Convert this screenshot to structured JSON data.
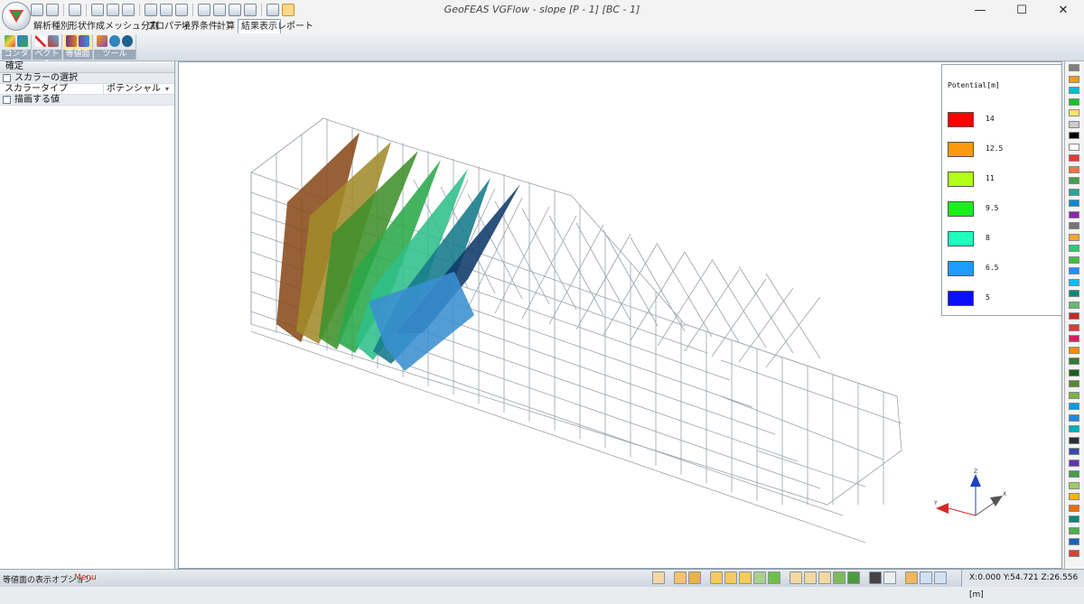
{
  "window": {
    "title": "GeoFEAS VGFlow - slope [P - 1] [BC - 1]",
    "controls": {
      "minimize": "—",
      "maximize": "☐",
      "close": "✕"
    }
  },
  "tabs": [
    "解析種別",
    "形状作成",
    "メッシュ分割",
    "プロパティ",
    "境界条件",
    "計算",
    "結果表示",
    "レポート"
  ],
  "active_tab": "結果表示",
  "ribbon": {
    "groups": [
      "コンタ図",
      "ベクトル",
      "等値面",
      "ツール"
    ],
    "selected_group": "等値面"
  },
  "left_panel": {
    "header": "確定",
    "section_scalar": "スカラーの選択",
    "scalar_type_label": "スカラータイプ",
    "scalar_type_value": "ポテンシャル",
    "section_values": "描画する値"
  },
  "legend": {
    "title": "Potential[m]",
    "items": [
      {
        "value": "14",
        "color": "#ff0000"
      },
      {
        "value": "12.5",
        "color": "#ff9a10"
      },
      {
        "value": "11",
        "color": "#b2ff18"
      },
      {
        "value": "9.5",
        "color": "#1af01a"
      },
      {
        "value": "8",
        "color": "#1fffbe"
      },
      {
        "value": "6.5",
        "color": "#1f9cff"
      },
      {
        "value": "5",
        "color": "#0a10ff"
      }
    ]
  },
  "axes": {
    "x": "X",
    "y": "Y",
    "z": "Z"
  },
  "status": {
    "text": "等値面の表示オプション",
    "menu": "Menu",
    "coordinates": "X:0.000 Y:54.721 Z:26.556 [m]"
  }
}
